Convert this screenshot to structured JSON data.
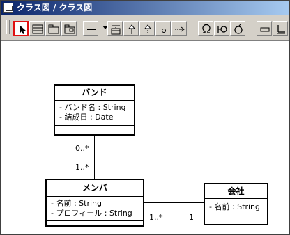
{
  "window": {
    "title": "クラス図 / クラス図"
  },
  "toolbar": {
    "tools": [
      {
        "name": "select-tool-button",
        "icon": "pointer-icon",
        "selected": true
      },
      {
        "name": "class-tool-button",
        "icon": "class-box-icon"
      },
      {
        "name": "package-tool-button",
        "icon": "package-icon"
      },
      {
        "name": "subsystem-tool-button",
        "icon": "subsystem-icon"
      },
      {
        "name": "association-tool-button",
        "icon": "association-line-icon"
      },
      {
        "name": "association-class-tool-button",
        "icon": "association-class-icon"
      },
      {
        "name": "generalization-tool-button",
        "icon": "generalization-arrow-icon"
      },
      {
        "name": "realization-tool-button",
        "icon": "realization-arrow-icon"
      },
      {
        "name": "interface-tool-button",
        "icon": "interface-circle-icon"
      },
      {
        "name": "dependency-tool-button",
        "icon": "dependency-arrow-icon"
      },
      {
        "name": "lollipop-tool-button",
        "icon": "omega-icon"
      },
      {
        "name": "required-interface-tool-button",
        "icon": "socket-icon"
      },
      {
        "name": "self-association-tool-button",
        "icon": "self-loop-icon"
      },
      {
        "name": "note-tool-button",
        "icon": "note-icon"
      },
      {
        "name": "anchor-tool-button",
        "icon": "anchor-icon"
      }
    ]
  },
  "diagram": {
    "classes": {
      "band": {
        "name": "バンド",
        "attributes": [
          "- バンド名 : String",
          "- 結成日 : Date"
        ]
      },
      "member": {
        "name": "メンバ",
        "attributes": [
          "- 名前 : String",
          "- プロフィール : String"
        ]
      },
      "company": {
        "name": "会社",
        "attributes": [
          "- 名前 : String"
        ]
      }
    },
    "multiplicities": {
      "band_member_top": "0..*",
      "band_member_bottom": "1..*",
      "member_company_left": "1..*",
      "member_company_right": "1"
    }
  }
}
